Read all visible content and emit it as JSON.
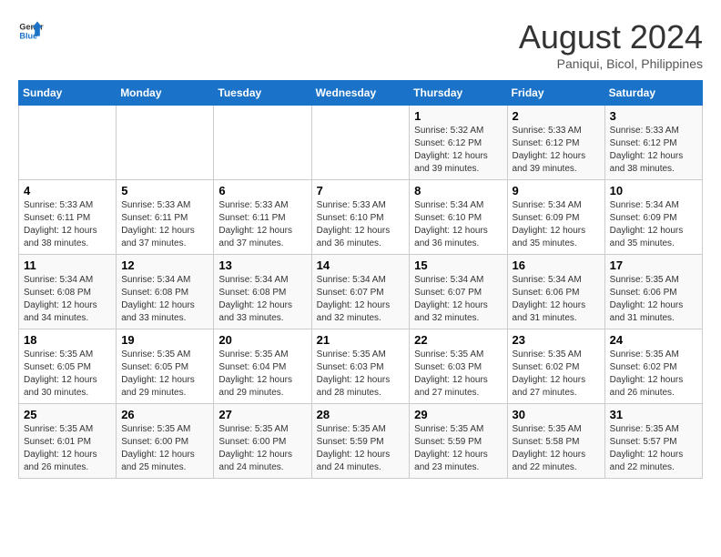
{
  "logo": {
    "line1": "General",
    "line2": "Blue"
  },
  "title": "August 2024",
  "subtitle": "Paniqui, Bicol, Philippines",
  "weekdays": [
    "Sunday",
    "Monday",
    "Tuesday",
    "Wednesday",
    "Thursday",
    "Friday",
    "Saturday"
  ],
  "weeks": [
    [
      {
        "day": "",
        "info": ""
      },
      {
        "day": "",
        "info": ""
      },
      {
        "day": "",
        "info": ""
      },
      {
        "day": "",
        "info": ""
      },
      {
        "day": "1",
        "info": "Sunrise: 5:32 AM\nSunset: 6:12 PM\nDaylight: 12 hours and 39 minutes."
      },
      {
        "day": "2",
        "info": "Sunrise: 5:33 AM\nSunset: 6:12 PM\nDaylight: 12 hours and 39 minutes."
      },
      {
        "day": "3",
        "info": "Sunrise: 5:33 AM\nSunset: 6:12 PM\nDaylight: 12 hours and 38 minutes."
      }
    ],
    [
      {
        "day": "4",
        "info": "Sunrise: 5:33 AM\nSunset: 6:11 PM\nDaylight: 12 hours and 38 minutes."
      },
      {
        "day": "5",
        "info": "Sunrise: 5:33 AM\nSunset: 6:11 PM\nDaylight: 12 hours and 37 minutes."
      },
      {
        "day": "6",
        "info": "Sunrise: 5:33 AM\nSunset: 6:11 PM\nDaylight: 12 hours and 37 minutes."
      },
      {
        "day": "7",
        "info": "Sunrise: 5:33 AM\nSunset: 6:10 PM\nDaylight: 12 hours and 36 minutes."
      },
      {
        "day": "8",
        "info": "Sunrise: 5:34 AM\nSunset: 6:10 PM\nDaylight: 12 hours and 36 minutes."
      },
      {
        "day": "9",
        "info": "Sunrise: 5:34 AM\nSunset: 6:09 PM\nDaylight: 12 hours and 35 minutes."
      },
      {
        "day": "10",
        "info": "Sunrise: 5:34 AM\nSunset: 6:09 PM\nDaylight: 12 hours and 35 minutes."
      }
    ],
    [
      {
        "day": "11",
        "info": "Sunrise: 5:34 AM\nSunset: 6:08 PM\nDaylight: 12 hours and 34 minutes."
      },
      {
        "day": "12",
        "info": "Sunrise: 5:34 AM\nSunset: 6:08 PM\nDaylight: 12 hours and 33 minutes."
      },
      {
        "day": "13",
        "info": "Sunrise: 5:34 AM\nSunset: 6:08 PM\nDaylight: 12 hours and 33 minutes."
      },
      {
        "day": "14",
        "info": "Sunrise: 5:34 AM\nSunset: 6:07 PM\nDaylight: 12 hours and 32 minutes."
      },
      {
        "day": "15",
        "info": "Sunrise: 5:34 AM\nSunset: 6:07 PM\nDaylight: 12 hours and 32 minutes."
      },
      {
        "day": "16",
        "info": "Sunrise: 5:34 AM\nSunset: 6:06 PM\nDaylight: 12 hours and 31 minutes."
      },
      {
        "day": "17",
        "info": "Sunrise: 5:35 AM\nSunset: 6:06 PM\nDaylight: 12 hours and 31 minutes."
      }
    ],
    [
      {
        "day": "18",
        "info": "Sunrise: 5:35 AM\nSunset: 6:05 PM\nDaylight: 12 hours and 30 minutes."
      },
      {
        "day": "19",
        "info": "Sunrise: 5:35 AM\nSunset: 6:05 PM\nDaylight: 12 hours and 29 minutes."
      },
      {
        "day": "20",
        "info": "Sunrise: 5:35 AM\nSunset: 6:04 PM\nDaylight: 12 hours and 29 minutes."
      },
      {
        "day": "21",
        "info": "Sunrise: 5:35 AM\nSunset: 6:03 PM\nDaylight: 12 hours and 28 minutes."
      },
      {
        "day": "22",
        "info": "Sunrise: 5:35 AM\nSunset: 6:03 PM\nDaylight: 12 hours and 27 minutes."
      },
      {
        "day": "23",
        "info": "Sunrise: 5:35 AM\nSunset: 6:02 PM\nDaylight: 12 hours and 27 minutes."
      },
      {
        "day": "24",
        "info": "Sunrise: 5:35 AM\nSunset: 6:02 PM\nDaylight: 12 hours and 26 minutes."
      }
    ],
    [
      {
        "day": "25",
        "info": "Sunrise: 5:35 AM\nSunset: 6:01 PM\nDaylight: 12 hours and 26 minutes."
      },
      {
        "day": "26",
        "info": "Sunrise: 5:35 AM\nSunset: 6:00 PM\nDaylight: 12 hours and 25 minutes."
      },
      {
        "day": "27",
        "info": "Sunrise: 5:35 AM\nSunset: 6:00 PM\nDaylight: 12 hours and 24 minutes."
      },
      {
        "day": "28",
        "info": "Sunrise: 5:35 AM\nSunset: 5:59 PM\nDaylight: 12 hours and 24 minutes."
      },
      {
        "day": "29",
        "info": "Sunrise: 5:35 AM\nSunset: 5:59 PM\nDaylight: 12 hours and 23 minutes."
      },
      {
        "day": "30",
        "info": "Sunrise: 5:35 AM\nSunset: 5:58 PM\nDaylight: 12 hours and 22 minutes."
      },
      {
        "day": "31",
        "info": "Sunrise: 5:35 AM\nSunset: 5:57 PM\nDaylight: 12 hours and 22 minutes."
      }
    ]
  ]
}
